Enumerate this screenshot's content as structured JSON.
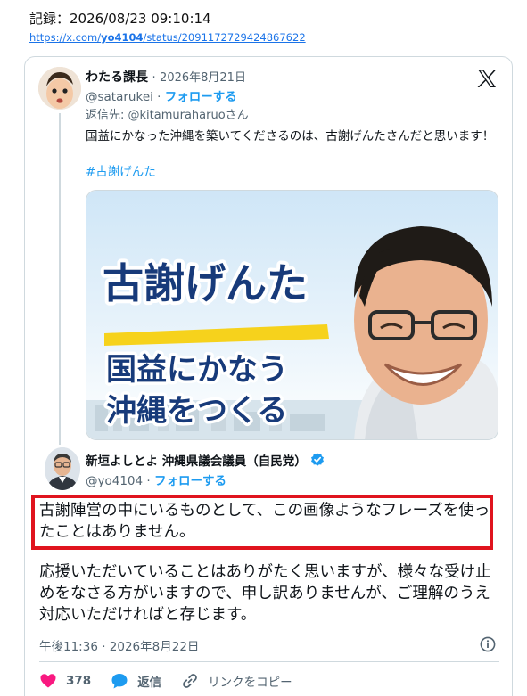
{
  "record": {
    "label": "記録：2026/08/23 09:10:14",
    "url_prefix": "https://x.com/",
    "url_user": "yo4104",
    "url_suffix": "/status/2091172729424867622"
  },
  "parent_tweet": {
    "name": "わたる課長",
    "dot": "·",
    "date": "2026年8月21日",
    "handle": "@satarukei",
    "handle_dot": "·",
    "follow": "フォローする",
    "reply_to": "返信先: @kitamuraharuoさん",
    "text": "国益にかなった沖縄を築いてくださるのは、古謝げんたさんだと思います！",
    "hashtag": "#古謝げんた",
    "image": {
      "line1": "古謝げんた",
      "line2": "国益にかなう",
      "line3": "沖縄をつくる"
    }
  },
  "main_tweet": {
    "name": "新垣よしとよ 沖縄県議会議員（自民党）",
    "handle": "@yo4104",
    "handle_dot": "·",
    "follow": "フォローする",
    "text_highlighted": "古謝陣営の中にいるものとして、この画像ようなフレーズを使ったことはありません。",
    "text_body": "応援いただいていることはありがたく思いますが、様々な受け止めをなさる方がいますので、申し訳ありませんが、ご理解のうえ対応いただければと存じます。",
    "timestamp": "午後11:36 · 2026年8月22日"
  },
  "actions": {
    "like_count": "378",
    "reply_label": "返信",
    "copy_link_label": "リンクをコピー"
  },
  "icons": [
    "x-logo-icon",
    "verified-badge-icon",
    "info-icon",
    "heart-icon",
    "reply-bubble-icon",
    "link-icon"
  ],
  "colors": {
    "link_blue": "#1d9bf0",
    "highlight_red": "#e0141e",
    "heart_pink": "#f91880"
  }
}
